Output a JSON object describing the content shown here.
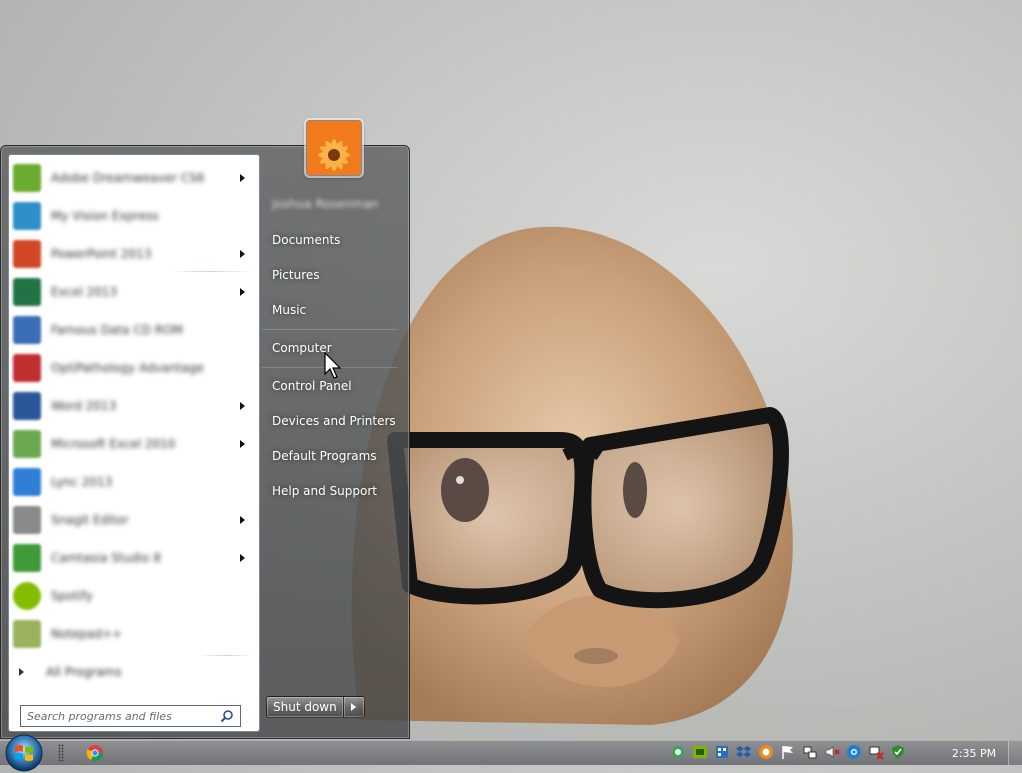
{
  "wallpaper": {
    "description_icon": "guinea-pig-wallpaper"
  },
  "start_menu": {
    "programs": [
      {
        "label": "Adobe Dreamweaver CS6",
        "icon": "dreamweaver-icon",
        "color": "#6bab2d",
        "has_submenu": true
      },
      {
        "label": "My Vision Express",
        "icon": "app-icon",
        "color": "#2f8fc8",
        "has_submenu": false
      },
      {
        "label": "PowerPoint 2013",
        "icon": "powerpoint-icon",
        "color": "#d24726",
        "has_submenu": true
      },
      {
        "label": "Excel 2013",
        "icon": "excel-icon",
        "color": "#217346",
        "has_submenu": true
      },
      {
        "label": "Famous Data CD ROM",
        "icon": "app-icon",
        "color": "#3b6fb5",
        "has_submenu": false
      },
      {
        "label": "OptiPathology Advantage",
        "icon": "app-icon",
        "color": "#c03030",
        "has_submenu": false
      },
      {
        "label": "Word 2013",
        "icon": "word-icon",
        "color": "#2b579a",
        "has_submenu": true
      },
      {
        "label": "Microsoft Excel 2010",
        "icon": "excel-icon",
        "color": "#6aa84f",
        "has_submenu": true
      },
      {
        "label": "Lync 2013",
        "icon": "lync-icon",
        "color": "#2f7fd6",
        "has_submenu": false
      },
      {
        "label": "Snagit Editor",
        "icon": "app-icon",
        "color": "#8a8a8a",
        "has_submenu": true
      },
      {
        "label": "Camtasia Studio 8",
        "icon": "camtasia-icon",
        "color": "#3f9b3a",
        "has_submenu": true
      },
      {
        "label": "Spotify",
        "icon": "spotify-icon",
        "color": "#84bd00",
        "has_submenu": false
      },
      {
        "label": "Notepad++",
        "icon": "notepad-icon",
        "color": "#9ab25c",
        "has_submenu": false
      }
    ],
    "all_programs_label": "All Programs",
    "search_placeholder": "Search programs and files",
    "username": "Joshua Rosenman",
    "right_items": {
      "documents": "Documents",
      "pictures": "Pictures",
      "music": "Music",
      "computer": "Computer",
      "control_panel": "Control Panel",
      "devices_printers": "Devices and Printers",
      "default_programs": "Default Programs",
      "help_support": "Help and Support"
    },
    "shutdown_label": "Shut down"
  },
  "taskbar": {
    "clock": "2:35 PM",
    "tray_icons": [
      "sync-icon",
      "nvidia-icon",
      "network-app-icon",
      "dropbox-icon",
      "orange-app-icon",
      "action-center-flag-icon",
      "network-icon",
      "volume-muted-icon",
      "blue-app-icon",
      "network-error-icon",
      "security-icon"
    ]
  }
}
